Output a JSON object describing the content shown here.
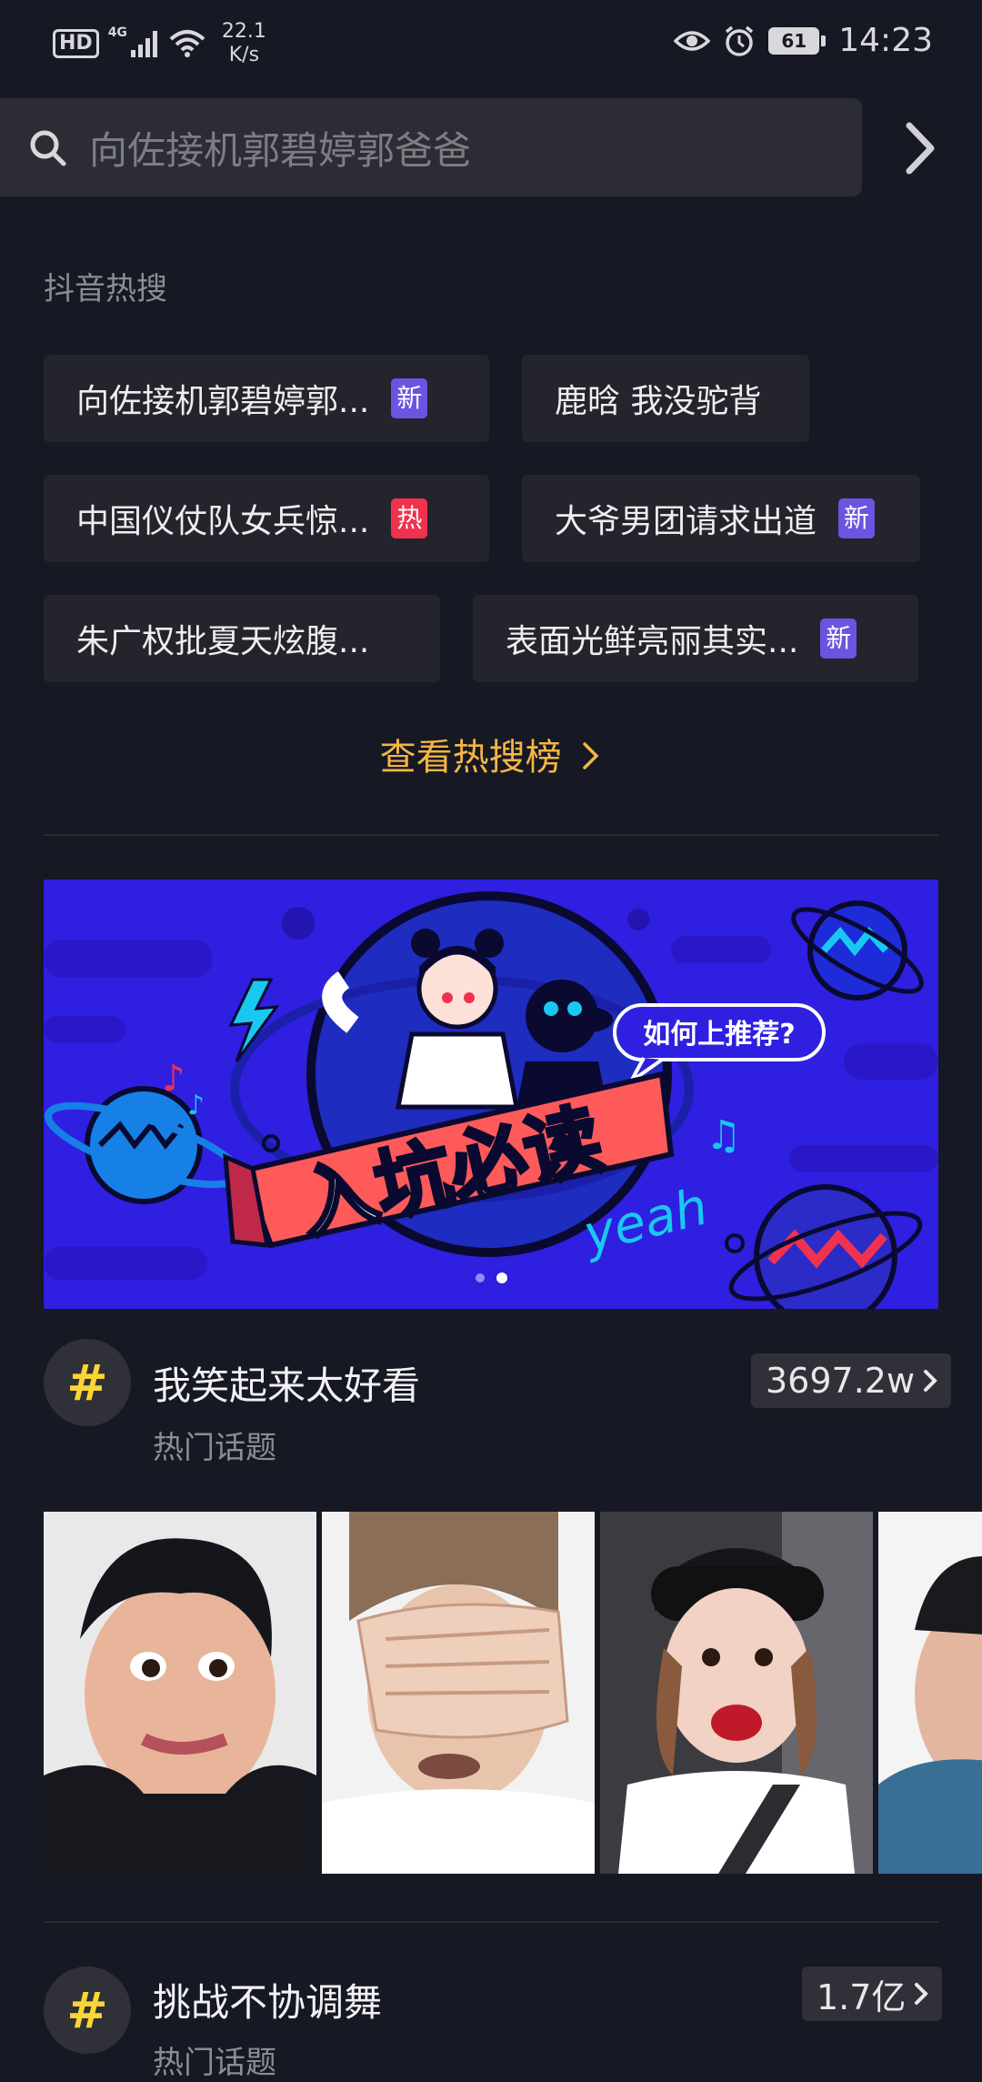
{
  "status_bar": {
    "hd": "HD",
    "network": "4G",
    "speed_value": "22.1",
    "speed_unit": "K/s",
    "battery": "61",
    "time": "14:23"
  },
  "search": {
    "placeholder": "向佐接机郭碧婷郭爸爸"
  },
  "hot_search": {
    "title": "抖音热搜",
    "chips": [
      {
        "label": "向佐接机郭碧婷郭...",
        "badge": "新"
      },
      {
        "label": "鹿晗 我没驼背",
        "badge": ""
      },
      {
        "label": "中国仪仗队女兵惊...",
        "badge": "热"
      },
      {
        "label": "大爷男团请求出道",
        "badge": "新"
      },
      {
        "label": "朱广权批夏天炫腹...",
        "badge": ""
      },
      {
        "label": "表面光鲜亮丽其实...",
        "badge": "新"
      }
    ],
    "more_link": "查看热搜榜"
  },
  "banner": {
    "main_text": "入坑必读",
    "bubble_text": "如何上推荐?",
    "script_text": "yeah",
    "page_count": 2,
    "active_page": 2
  },
  "topics": [
    {
      "title": "我笑起来太好看",
      "subtitle": "热门话题",
      "count": "3697.2w"
    },
    {
      "title": "挑战不协调舞",
      "subtitle": "热门话题",
      "count": "1.7亿"
    }
  ],
  "colors": {
    "background": "#161823",
    "accent_link": "#f5b544",
    "badge_new": "#6c54e0",
    "badge_hot": "#f0324e",
    "topic_hash": "#fbd533",
    "banner_bg": "#2f1fe0"
  }
}
